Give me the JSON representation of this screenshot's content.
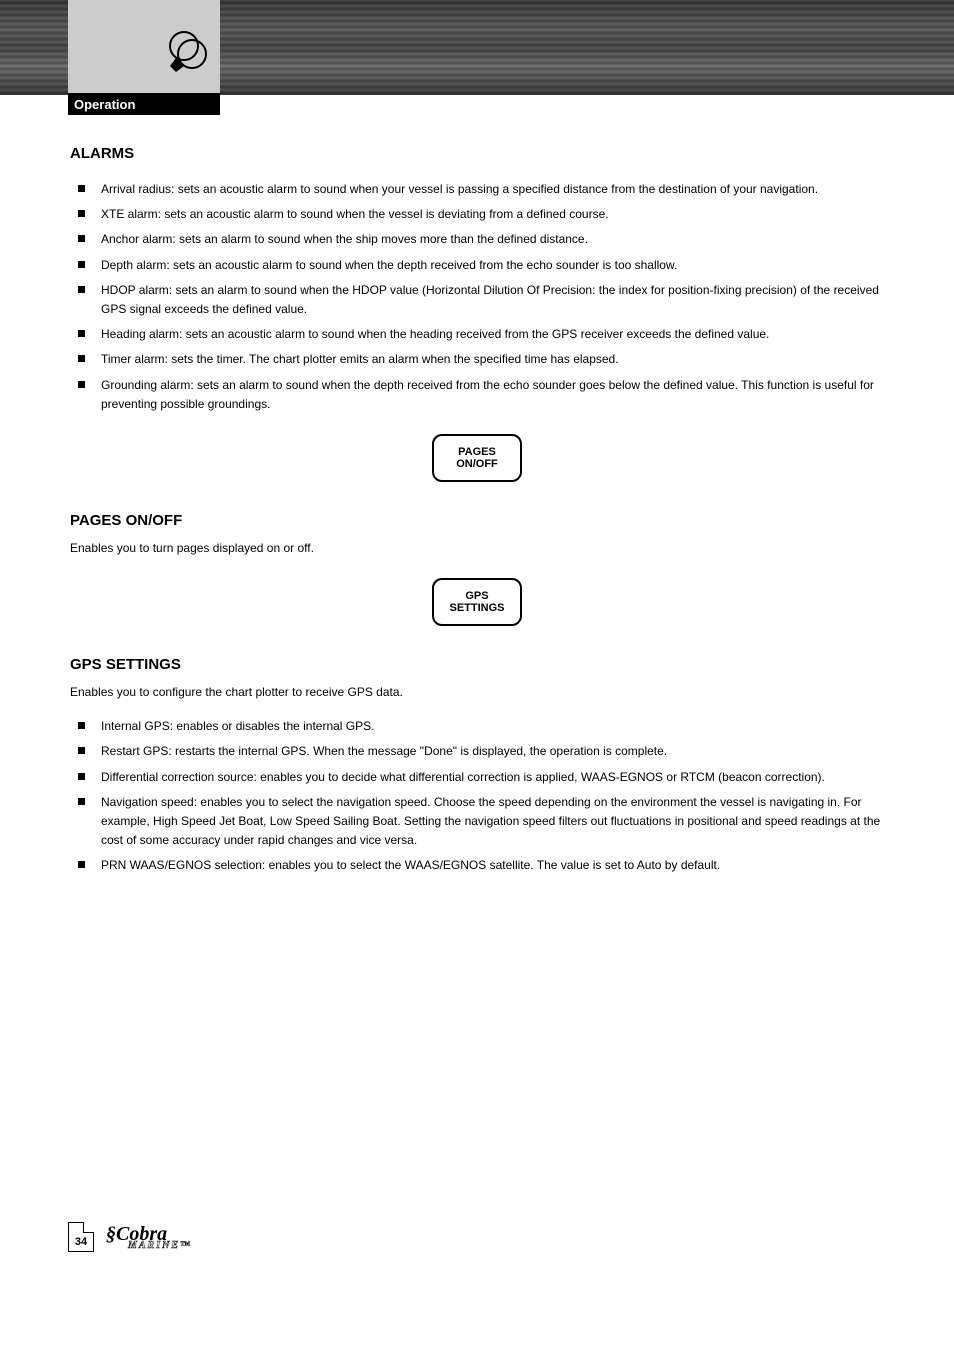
{
  "header": {
    "tab_label": "Operation"
  },
  "alarms_section": {
    "title": "ALARMS",
    "bullets": [
      "Arrival radius: sets an acoustic alarm to sound when your vessel is passing a specified distance from the destination of your navigation.",
      "XTE alarm: sets an acoustic alarm to sound when the vessel is deviating from a defined course.",
      "Anchor alarm: sets an alarm to sound when the ship moves more than the defined distance.",
      "Depth alarm: sets an acoustic alarm to sound when the depth received from the echo sounder is too shallow.",
      "HDOP alarm: sets an alarm to sound when the HDOP value (Horizontal Dilution Of Precision: the index for position-fixing precision) of the received GPS signal exceeds the defined value.",
      "Heading alarm: sets an acoustic alarm to sound when the heading received from the GPS receiver exceeds the defined value.",
      "Timer alarm: sets the timer. The chart plotter emits an alarm when the specified time has elapsed.",
      "Grounding alarm: sets an alarm to sound when the depth received from the echo sounder goes below the defined value. This function is useful for preventing possible groundings."
    ]
  },
  "button1": "PAGES ON/OFF",
  "pages_section": {
    "title": "PAGES ON/OFF",
    "text": "Enables you to turn pages displayed on or off."
  },
  "button2": "GPS SETTINGS",
  "gps_section": {
    "title": "GPS SETTINGS",
    "text": "Enables you to configure the chart plotter to receive GPS data.",
    "bullets": [
      "Internal GPS: enables or disables the internal GPS.",
      "Restart GPS: restarts the internal GPS. When the message \"Done\" is displayed, the operation is complete.",
      "Differential correction source: enables you to decide what differential correction is applied, WAAS-EGNOS or RTCM (beacon correction).",
      "Navigation speed: enables you to select the navigation speed. Choose the speed depending on the environment the vessel is navigating in. For example, High Speed Jet Boat, Low Speed Sailing Boat. Setting the navigation speed filters out fluctuations in positional and speed readings at the cost of some accuracy under rapid changes and vice versa.",
      "PRN WAAS/EGNOS selection: enables you to select the WAAS/EGNOS satellite. The value is set to Auto by default."
    ]
  },
  "footer": {
    "page_number": "34"
  }
}
